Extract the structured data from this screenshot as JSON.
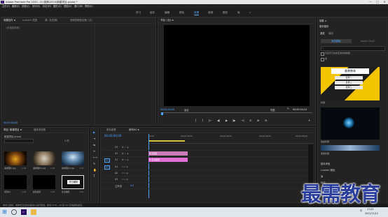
{
  "app": {
    "logo_text": "Pr",
    "title": "Adobe Premiere Pro 2020 - D:\\视频\\2020\\新建项目.prproj *",
    "window_controls": [
      "—",
      "□",
      "✕"
    ]
  },
  "menu": [
    "文件(F)",
    "编辑(E)",
    "剪辑(C)",
    "序列(S)",
    "标记(M)",
    "图形(G)",
    "视图(V)",
    "窗口(W)",
    "帮助(H)"
  ],
  "workspaces": {
    "items": [
      "学习",
      "组件",
      "编辑",
      "颜色",
      "效果",
      "音频",
      "图形",
      "库"
    ],
    "active_index": 4,
    "more": "»"
  },
  "top_left_panel": {
    "tabs": [
      "效果控件 ≡",
      "Lumetri 范围",
      "源: (无剪辑)",
      "音频剪辑混合器: (无)"
    ],
    "content": "（未选择剪辑）",
    "timecode": "00;00;00;00"
  },
  "program_monitor": {
    "tab": "节目: (无)  ≡",
    "timecode_left": "00;00;00;00",
    "fit": "适合",
    "quality": "完整",
    "timecode_right": "00;00;04;24",
    "controls": [
      "{",
      "}",
      "|←",
      "◀|",
      "▶",
      "|▶",
      "→|",
      "⊡",
      "⊞",
      "⊟",
      "+"
    ]
  },
  "right_panel": {
    "tabs": [
      "效果 ≡",
      "基本图形"
    ],
    "subtabs": [
      "浏览",
      "编辑"
    ],
    "active_button": "我的模板",
    "inactive_button": "Adobe Stock",
    "checkbox_1": "仅显示已在此应用中的模板",
    "checkbox_2": "库",
    "template_1_caption": "标题",
    "template_1_title": "最需教育",
    "template_1_lines": [
      "目录一",
      "目录二",
      "目录三"
    ],
    "template_2_caption": "动态标题",
    "template_3_caption": "简易标题",
    "bottom_items": [
      "基本声音",
      "Lumetri 颜色",
      "库",
      "标记"
    ]
  },
  "project_panel": {
    "tabs": [
      "项目: 新建项目  ≡",
      "媒体浏览器"
    ],
    "project_name": "新建项目.prproj",
    "count": "5 项",
    "search_placeholder": "",
    "items": [
      {
        "name": "素材图片.jpg",
        "duration": "4;29"
      },
      {
        "name": "素材图片2.jpg",
        "duration": "4;29"
      },
      {
        "name": "素材图片3.jpg",
        "duration": "4;29"
      },
      {
        "name": "序列01",
        "duration": "4;29"
      },
      {
        "name": "颜色遮罩",
        "duration": "4;29"
      },
      {
        "name": "冬日暖阳",
        "duration": "4;29"
      }
    ],
    "title_card": "冬日暖阳"
  },
  "tools": [
    "▶",
    "⇥",
    "⇆",
    "✂",
    "⟷",
    "✎",
    "✋",
    "T"
  ],
  "timeline": {
    "tabs": [
      "颜色遮罩",
      "序列01  ≡"
    ],
    "timecode": "00;00;00;00",
    "ruler": [
      "00;00",
      "00;00;02;00",
      "00;00;04;00",
      "00;00;06;00",
      "00;00;08;00"
    ],
    "video_tracks": [
      "V3",
      "V2",
      "V1"
    ],
    "audio_tracks": [
      "A1",
      "A2",
      "A3"
    ],
    "master": "主声道",
    "master_value": "0.0",
    "clips": [
      {
        "label": "冬日暖阳",
        "color": "#c97ab8"
      },
      {
        "label": "fx 冬日暖阳",
        "color": "#e26fd6"
      }
    ]
  },
  "status_bar": "单击以选择，或单击空白处并拖动以进行框选。使用 Shift、Alt 和 Ctrl 获得其他选项。",
  "watermark": "最需教育",
  "taskbar": {
    "time": "17:02",
    "date": "2021/11/12",
    "lang": "中"
  }
}
